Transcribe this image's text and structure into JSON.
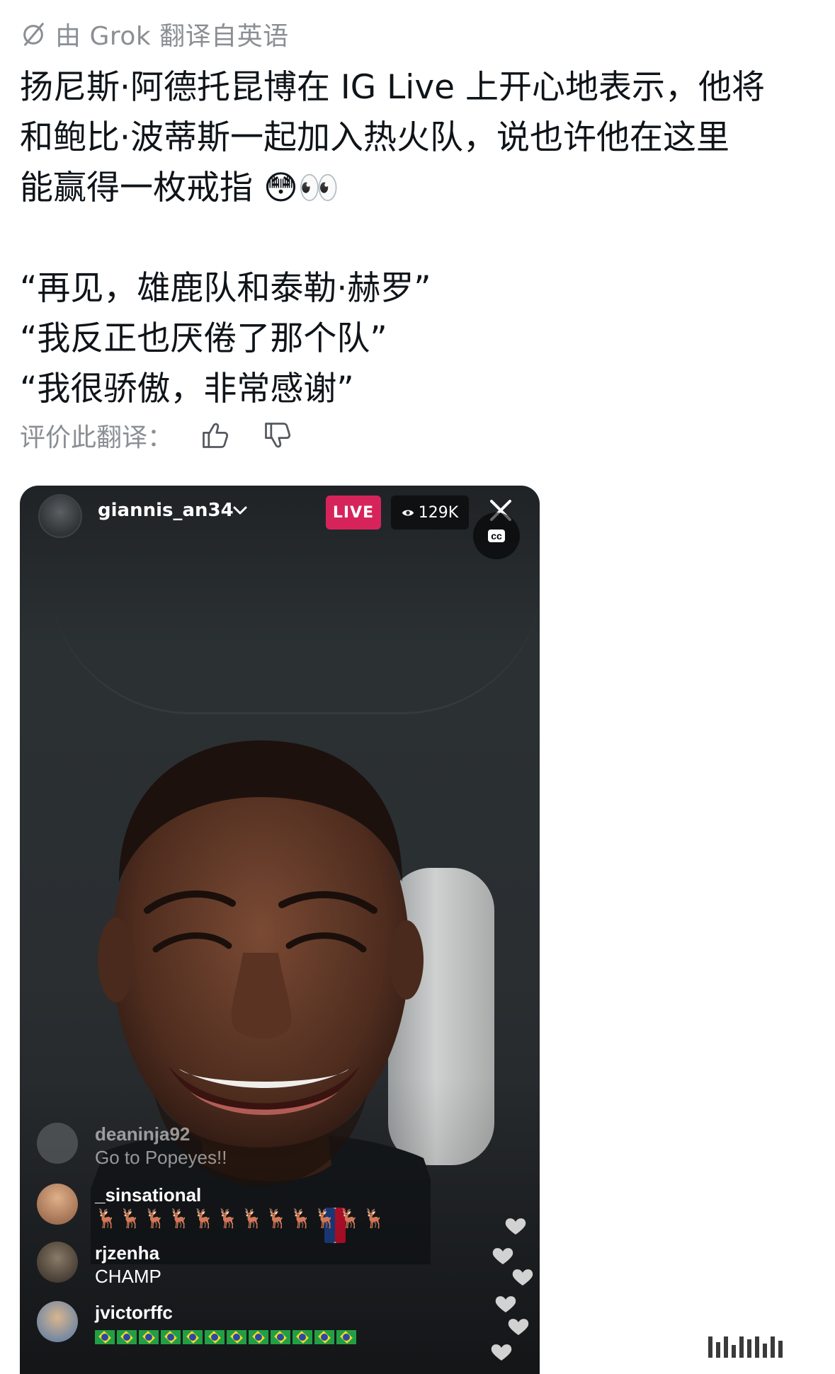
{
  "header": {
    "icon": "grok-slash-icon",
    "label": "由 Grok 翻译自英语"
  },
  "post": {
    "line1": "扬尼斯·阿德托昆博在 IG Live 上开心地表示，他将",
    "line2": "和鲍比·波蒂斯一起加入热火队，说也许他在这里",
    "line3": "能赢得一枚戒指 😳👀",
    "quote1": "“再见，雄鹿队和泰勒·赫罗”",
    "quote2": "“我反正也厌倦了那个队”",
    "quote3": "“我很骄傲，非常感谢”"
  },
  "rating": {
    "label": "评价此翻译：",
    "thumbs_up_icon": "thumbs-up-icon",
    "thumbs_down_icon": "thumbs-down-icon"
  },
  "live": {
    "username": "giannis_an34",
    "live_badge": "LIVE",
    "viewers": "129K",
    "cc_label": "cc",
    "comments": [
      {
        "user": "deaninja92",
        "text": "Go to Popeyes!!",
        "avatar_color": "#6b6f72"
      },
      {
        "user": "_sinsational",
        "text": "🦌🦌🦌🦌🦌🦌🦌🦌🦌🦌🦌🦌",
        "avatar_color": "#c48a6a"
      },
      {
        "user": "rjzenha",
        "text": "CHAMP",
        "avatar_color": "#4a4036"
      },
      {
        "user": "jvictorffc",
        "text": "brazil-flag x12",
        "avatar_color": "#7aa0c8"
      }
    ]
  },
  "colors": {
    "live_badge": "#d6245b",
    "muted_text": "#8b8f94",
    "body_text": "#0f1419"
  }
}
